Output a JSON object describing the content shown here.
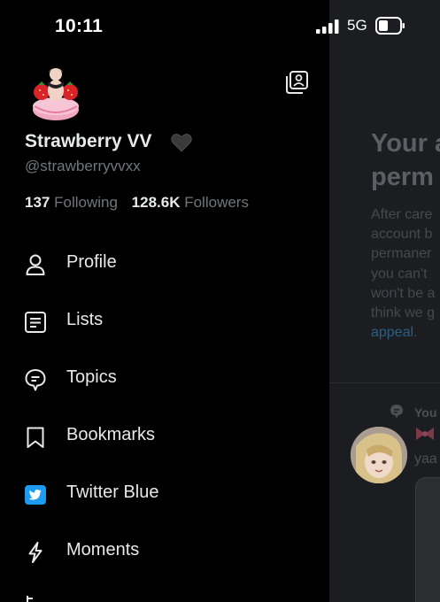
{
  "status_bar": {
    "time": "10:11",
    "network": "5G"
  },
  "profile": {
    "display_name": "Strawberry VV",
    "handle": "@strawberryvvxx",
    "following_count": "137",
    "following_label": "Following",
    "followers_count": "128.6K",
    "followers_label": "Followers"
  },
  "menu": [
    {
      "label": "Profile",
      "icon": "person-icon"
    },
    {
      "label": "Lists",
      "icon": "list-icon"
    },
    {
      "label": "Topics",
      "icon": "topics-icon"
    },
    {
      "label": "Bookmarks",
      "icon": "bookmark-icon"
    },
    {
      "label": "Twitter Blue",
      "icon": "twitter-blue-icon"
    },
    {
      "label": "Moments",
      "icon": "lightning-icon"
    }
  ],
  "background": {
    "title_line1": "Your a",
    "title_line2": "perm",
    "body_lines": [
      "After care",
      "account b",
      "permaner",
      "you can't",
      "won't be a",
      "think we g"
    ],
    "appeal_link": "appeal",
    "appeal_punct": ".",
    "tweet_label": "You",
    "reply_text": "yaa"
  },
  "colors": {
    "twitter_blue": "#1d9bf0",
    "background": "#000000",
    "muted_text": "#71767b"
  }
}
